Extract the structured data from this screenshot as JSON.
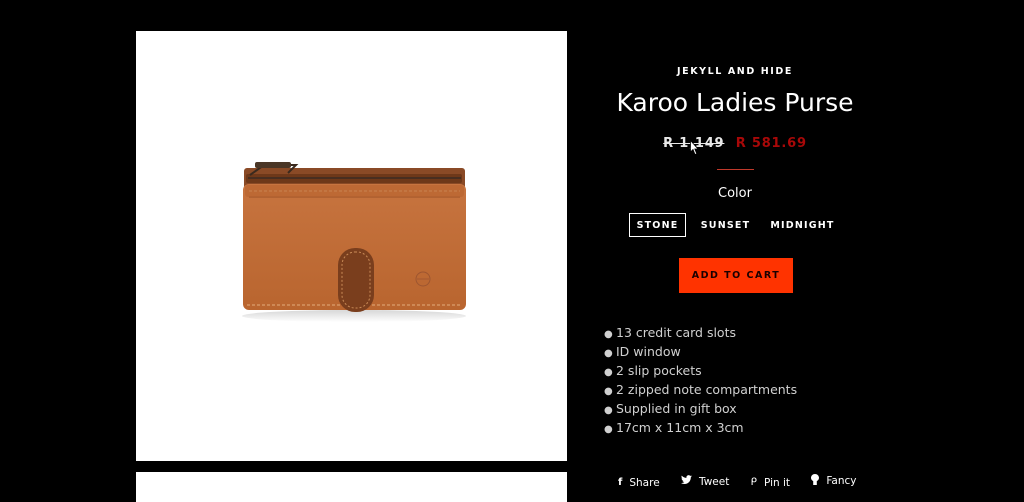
{
  "product": {
    "vendor": "JEKYLL AND HIDE",
    "title": "Karoo Ladies Purse",
    "compare_price": "R 1,149",
    "sale_price": "R 581.69",
    "option_label": "Color",
    "options": [
      "STONE",
      "SUNSET",
      "MIDNIGHT"
    ],
    "selected_option": "STONE",
    "add_to_cart_label": "ADD TO CART",
    "features": [
      "13 credit card slots",
      "ID window",
      "2 slip pockets",
      "2 zipped note compartments",
      "Supplied in gift box",
      "17cm x 11cm x 3cm"
    ]
  },
  "share": {
    "facebook_label": "Share",
    "twitter_label": "Tweet",
    "pinterest_label": "Pin it",
    "fancy_label": "Fancy"
  },
  "colors": {
    "background": "#000000",
    "sale_price": "#a80808",
    "accent": "#ff3300",
    "divider": "#c0392b"
  }
}
